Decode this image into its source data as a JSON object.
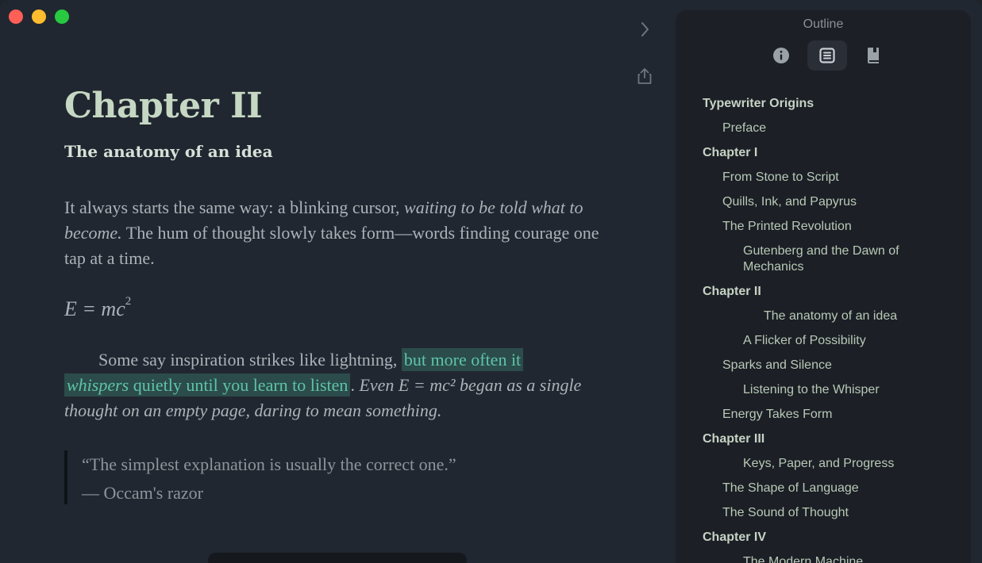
{
  "window": {
    "controls": [
      "close",
      "minimize",
      "zoom"
    ]
  },
  "editor": {
    "heading": "Chapter II",
    "subheading": "The anatomy of an idea",
    "p1": {
      "a": "It always starts the same way: a blinking cursor, ",
      "b": "waiting to be told what to become.",
      "c": " The hum of thought slowly takes form—words finding courage one tap at a time."
    },
    "formula": {
      "base": "E = mc",
      "exp": "2"
    },
    "p2": {
      "a": "Some say inspiration strikes like lightning, ",
      "hl1": "but more often it",
      "hl2a": "whispers",
      "hl2b": " quietly until you learn to listen",
      "d": ". ",
      "e": "Even E = mc² began as a single thought on an empty page, daring to mean something."
    },
    "quote": {
      "text": "“The simplest explanation is usually the correct one.”",
      "attribution": "—  Occam's razor"
    }
  },
  "toolbar": {
    "chevron": "chevron-right-icon",
    "share": "share-icon"
  },
  "sidebar": {
    "title": "Outline",
    "tabs": [
      {
        "name": "info-icon",
        "active": false
      },
      {
        "name": "outline-icon",
        "active": true
      },
      {
        "name": "book-icon",
        "active": false
      }
    ],
    "items": [
      {
        "label": "Typewriter Origins",
        "level": 0
      },
      {
        "label": "Preface",
        "level": 1
      },
      {
        "label": "Chapter I",
        "level": 0
      },
      {
        "label": "From Stone to Script",
        "level": 1
      },
      {
        "label": "Quills, Ink, and Papyrus",
        "level": 1
      },
      {
        "label": "The Printed Revolution",
        "level": 1
      },
      {
        "label": "Gutenberg and the Dawn of Mechanics",
        "level": 2
      },
      {
        "label": "Chapter II",
        "level": 0
      },
      {
        "label": "The anatomy of an idea",
        "level": 3
      },
      {
        "label": "A Flicker of Possibility",
        "level": 2
      },
      {
        "label": "Sparks and Silence",
        "level": 1
      },
      {
        "label": "Listening to the Whisper",
        "level": 2
      },
      {
        "label": "Energy Takes Form",
        "level": 1
      },
      {
        "label": "Chapter III",
        "level": 0
      },
      {
        "label": "Keys, Paper, and Progress",
        "level": 2
      },
      {
        "label": "The Shape of Language",
        "level": 1
      },
      {
        "label": "The Sound of Thought",
        "level": 1
      },
      {
        "label": "Chapter IV",
        "level": 0
      },
      {
        "label": "The Modern Machine",
        "level": 2
      }
    ]
  }
}
